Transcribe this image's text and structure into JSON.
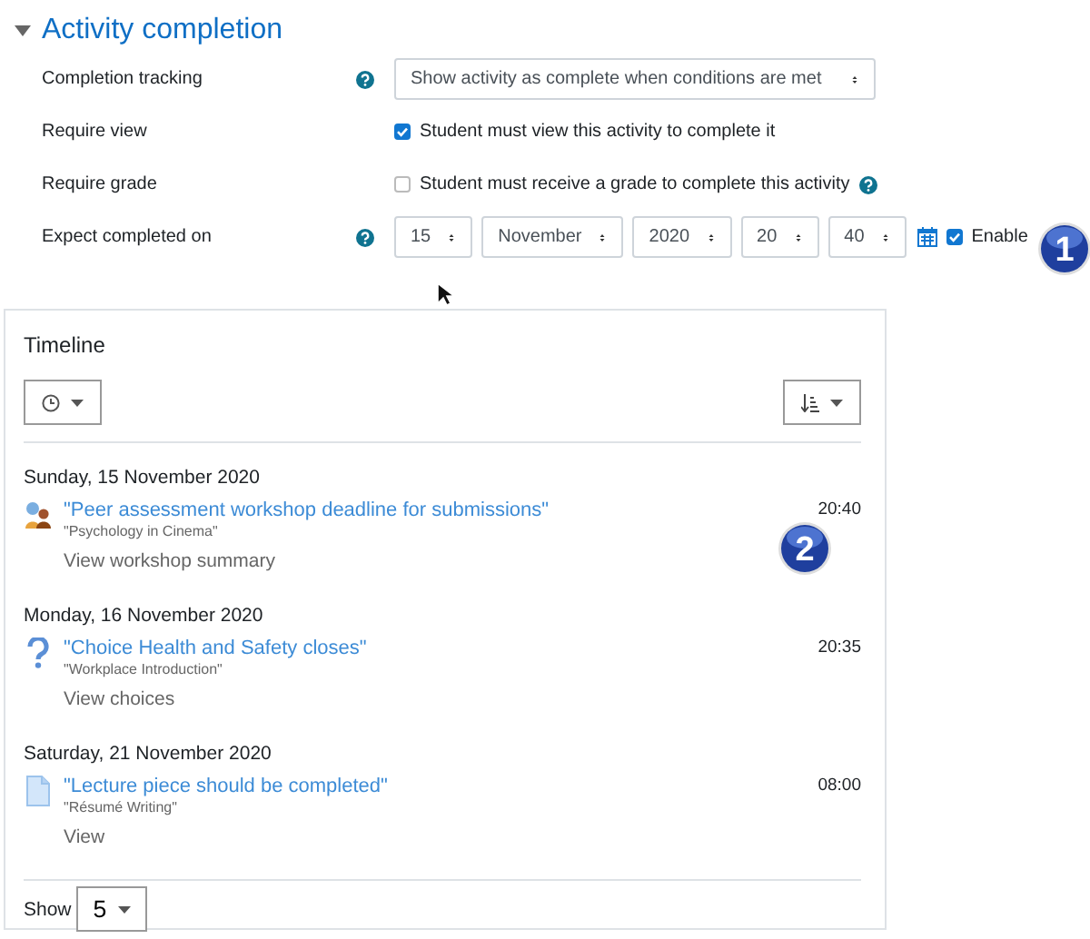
{
  "section": {
    "title": "Activity completion",
    "expanded": true
  },
  "fields": [
    {
      "kind": "select",
      "label": "Completion tracking",
      "help": true,
      "value": "Show activity as complete when conditions are met"
    },
    {
      "kind": "checkbox",
      "label": "Require view",
      "help": false,
      "checked": true,
      "text": "Student must view this activity to complete it",
      "text_help": false
    },
    {
      "kind": "checkbox",
      "label": "Require grade",
      "help": false,
      "checked": false,
      "text": "Student must receive a grade to complete this activity",
      "text_help": true
    },
    {
      "kind": "date",
      "label": "Expect completed on",
      "help": true,
      "parts": [
        "15",
        "November",
        "2020",
        "20",
        "40"
      ],
      "enable": {
        "label": "Enable",
        "checked": true
      }
    }
  ],
  "timeline": {
    "title": "Timeline",
    "groups": [
      {
        "date": "Sunday, 15 November 2020",
        "events": [
          {
            "kind": "workshop",
            "title": "\"Peer assessment workshop deadline for submissions\"",
            "course": "\"Psychology in Cinema\"",
            "action": "View workshop summary",
            "time": "20:40"
          }
        ]
      },
      {
        "date": "Monday, 16 November 2020",
        "events": [
          {
            "kind": "choice",
            "title": "\"Choice Health and Safety closes\"",
            "course": "\"Workplace Introduction\"",
            "action": "View choices",
            "time": "20:35"
          }
        ]
      },
      {
        "date": "Saturday, 21 November 2020",
        "events": [
          {
            "kind": "page",
            "title": "\"Lecture piece should be completed\"",
            "course": "\"Résumé Writing\"",
            "action": "View",
            "time": "08:00"
          }
        ]
      }
    ],
    "show": {
      "label": "Show",
      "value": "5"
    }
  },
  "callouts": [
    "1",
    "2"
  ]
}
